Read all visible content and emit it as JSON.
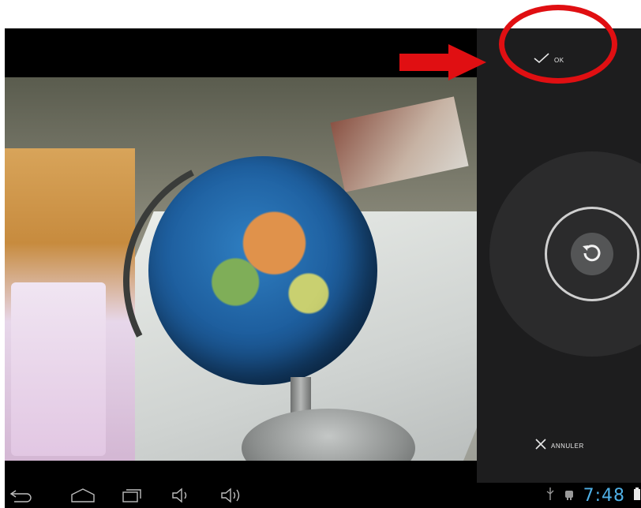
{
  "camera_panel": {
    "ok_label": "OK",
    "cancel_label": "ANNULER"
  },
  "status_bar": {
    "clock": "7:48"
  },
  "icons": {
    "ok": "checkmark-icon",
    "cancel": "close-icon",
    "rotate": "rotate-icon",
    "back": "back-icon",
    "home": "home-icon",
    "recents": "recent-apps-icon",
    "volume_down": "volume-down-icon",
    "volume_up": "volume-up-icon",
    "usb": "usb-icon",
    "android_debug": "android-debug-icon",
    "battery": "battery-icon"
  },
  "colors": {
    "annotation": "#e00f12",
    "status_blue": "#4fb0e6",
    "panel_bg": "#1d1d1e"
  }
}
